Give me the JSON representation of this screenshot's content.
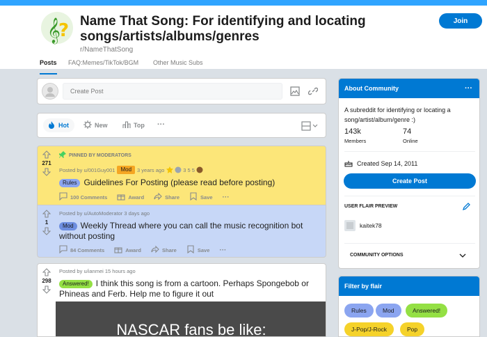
{
  "subreddit": {
    "title": "Name That Song: For identifying and locating songs/artists/albums/genres",
    "name": "r/NameThatSong",
    "join_label": "Join"
  },
  "tabs": [
    {
      "label": "Posts",
      "active": true
    },
    {
      "label": "FAQ:Memes/TikTok/BGM",
      "active": false
    },
    {
      "label": "Other Music Subs",
      "active": false
    }
  ],
  "create_post": {
    "placeholder": "Create Post"
  },
  "sort": {
    "hot": "Hot",
    "new": "New",
    "top": "Top",
    "more": "···"
  },
  "posts": [
    {
      "pinned_label": "PINNED BY MODERATORS",
      "votes": "271",
      "meta": "Posted by u/001Guy001",
      "user_flair": "Mod",
      "time": "3 years ago",
      "awards": "3   5   5",
      "flair": "Rules",
      "title": "Guidelines For Posting (please read before posting)",
      "comments": "100 Comments",
      "award": "Award",
      "share": "Share",
      "save": "Save",
      "more": "···"
    },
    {
      "votes": "1",
      "meta": "Posted by u/AutoModerator 3 days ago",
      "flair": "Mod",
      "title": "Weekly Thread where you can call the music recognition bot without posting",
      "comments": "84 Comments",
      "award": "Award",
      "share": "Share",
      "save": "Save",
      "more": "···"
    },
    {
      "votes": "298",
      "meta": "Posted by u/ianmei 15 hours ago",
      "flair": "Answered!",
      "title": "I think this song is from a cartoon. Perhaps Spongebob or Phineas and Ferb. Help me to figure it out",
      "image_text": "NASCAR fans be like:"
    }
  ],
  "about": {
    "header": "About Community",
    "more": "···",
    "description": "A subreddit for identifying or locating a song/artist/album/genre :)",
    "members_count": "143k",
    "members_label": "Members",
    "online_count": "74",
    "online_label": "Online",
    "created": "Created Sep 14, 2011",
    "create_post": "Create Post",
    "user_flair_title": "USER FLAIR PREVIEW",
    "username": "kaitek78",
    "community_options": "COMMUNITY OPTIONS"
  },
  "filter": {
    "header": "Filter by flair",
    "chips": [
      "Rules",
      "Mod",
      "Answered!",
      "J-Pop/J-Rock",
      "Pop"
    ]
  },
  "colors": {
    "accent": "#0079d3",
    "pinned_bg": "#fce679",
    "mod_bg": "#c7d7f7"
  }
}
